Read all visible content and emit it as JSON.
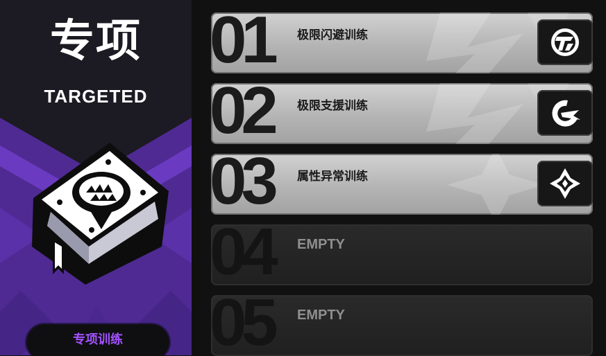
{
  "category": {
    "title_cn": "专项",
    "title_en": "TARGETED",
    "button_label": "专项训练",
    "icon": "training-manual-book-icon",
    "accent": "#5a2fa6"
  },
  "trainings": [
    {
      "number": "01",
      "label": "极限闪避训练",
      "icon": "dodge-emblem-icon",
      "state": "active"
    },
    {
      "number": "02",
      "label": "极限支援训练",
      "icon": "support-emblem-icon",
      "state": "active"
    },
    {
      "number": "03",
      "label": "属性异常训练",
      "icon": "anomaly-emblem-icon",
      "state": "active"
    },
    {
      "number": "04",
      "label": "EMPTY",
      "state": "empty"
    },
    {
      "number": "05",
      "label": "EMPTY",
      "state": "empty"
    }
  ],
  "colors": {
    "active_row": "#c4c4c4",
    "empty_row": "#262626",
    "button_text": "#a352ff"
  }
}
